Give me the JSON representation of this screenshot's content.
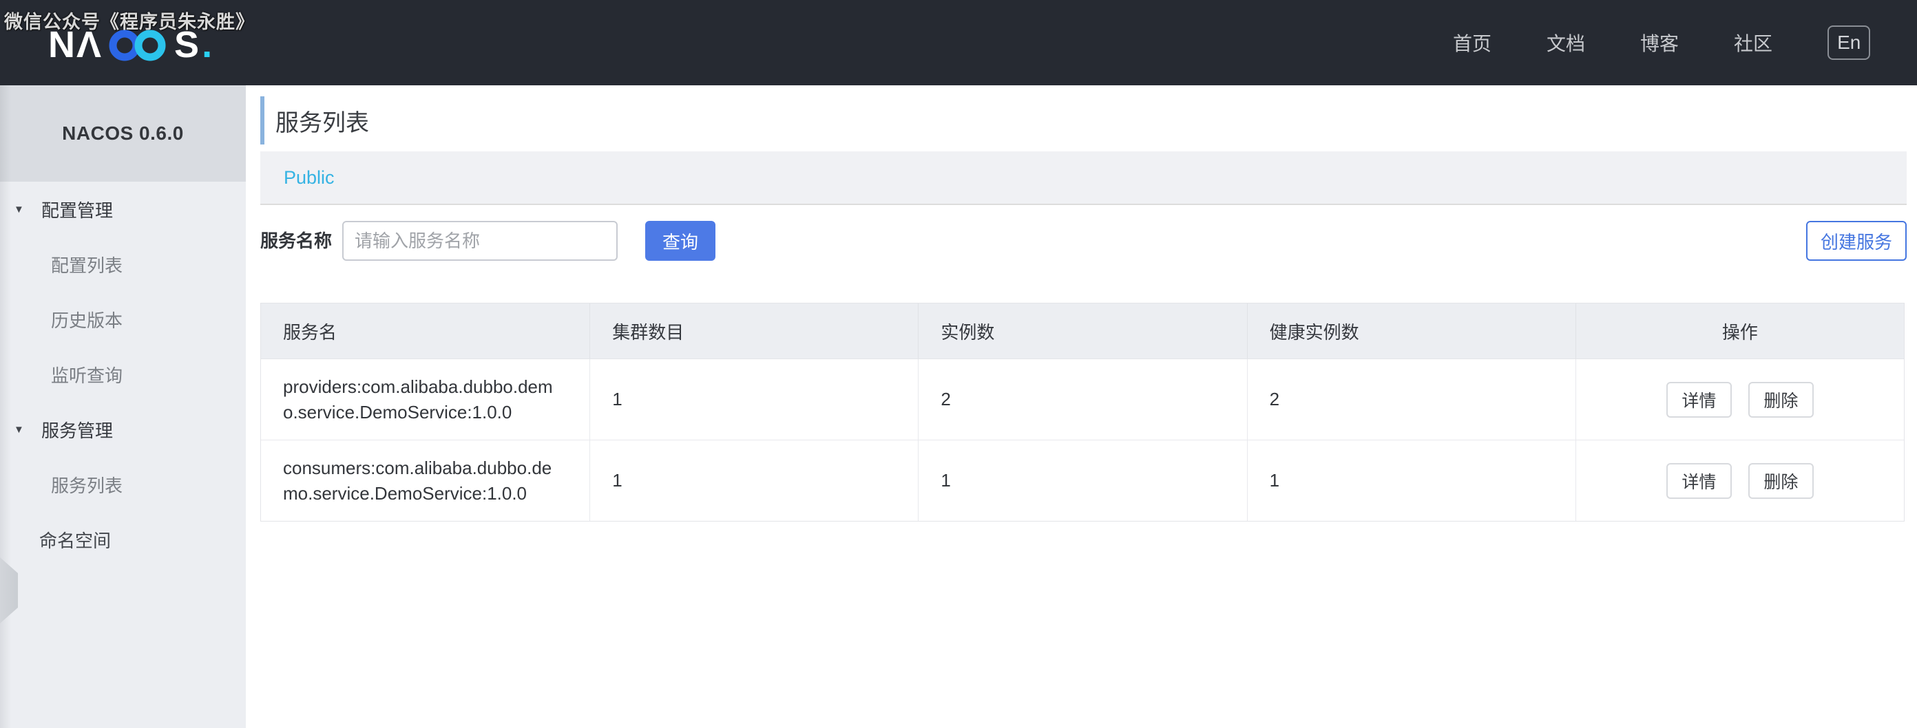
{
  "header": {
    "watermark": "微信公众号《程序员朱永胜》",
    "logo": {
      "part1": "N",
      "part2": "Λ",
      "part3": "S",
      "dot": "."
    },
    "nav": [
      {
        "label": "首页"
      },
      {
        "label": "文档"
      },
      {
        "label": "博客"
      },
      {
        "label": "社区"
      }
    ],
    "lang_button": "En"
  },
  "sidebar": {
    "brand": "NACOS 0.6.0",
    "groups": [
      {
        "label": "配置管理",
        "items": [
          "配置列表",
          "历史版本",
          "监听查询"
        ]
      },
      {
        "label": "服务管理",
        "items": [
          "服务列表"
        ]
      }
    ],
    "standalone_item": "命名空间"
  },
  "main": {
    "page_title": "服务列表",
    "namespace_tab": "Public",
    "search": {
      "label": "服务名称",
      "placeholder": "请输入服务名称",
      "query_button": "查询",
      "create_button": "创建服务"
    },
    "table": {
      "columns": [
        "服务名",
        "集群数目",
        "实例数",
        "健康实例数",
        "操作"
      ],
      "rows": [
        {
          "name": "providers:com.alibaba.dubbo.demo.service.DemoService:1.0.0",
          "clusters": "1",
          "instances": "2",
          "healthy": "2"
        },
        {
          "name": "consumers:com.alibaba.dubbo.demo.service.DemoService:1.0.0",
          "clusters": "1",
          "instances": "1",
          "healthy": "1"
        }
      ],
      "actions": {
        "detail": "详情",
        "delete": "删除"
      }
    }
  },
  "colors": {
    "header_bg": "#262a32",
    "sidebar_bg": "#eceef2",
    "brand_band_bg": "#d9dce1",
    "logo_blue": "#2b66e6",
    "logo_cyan": "#2bc3ec",
    "query_button_blue": "#4d7ae6",
    "create_button_blue": "#4576e0",
    "namespace_cyan": "#35b3e3",
    "title_accent_blue": "#8ab3de"
  }
}
